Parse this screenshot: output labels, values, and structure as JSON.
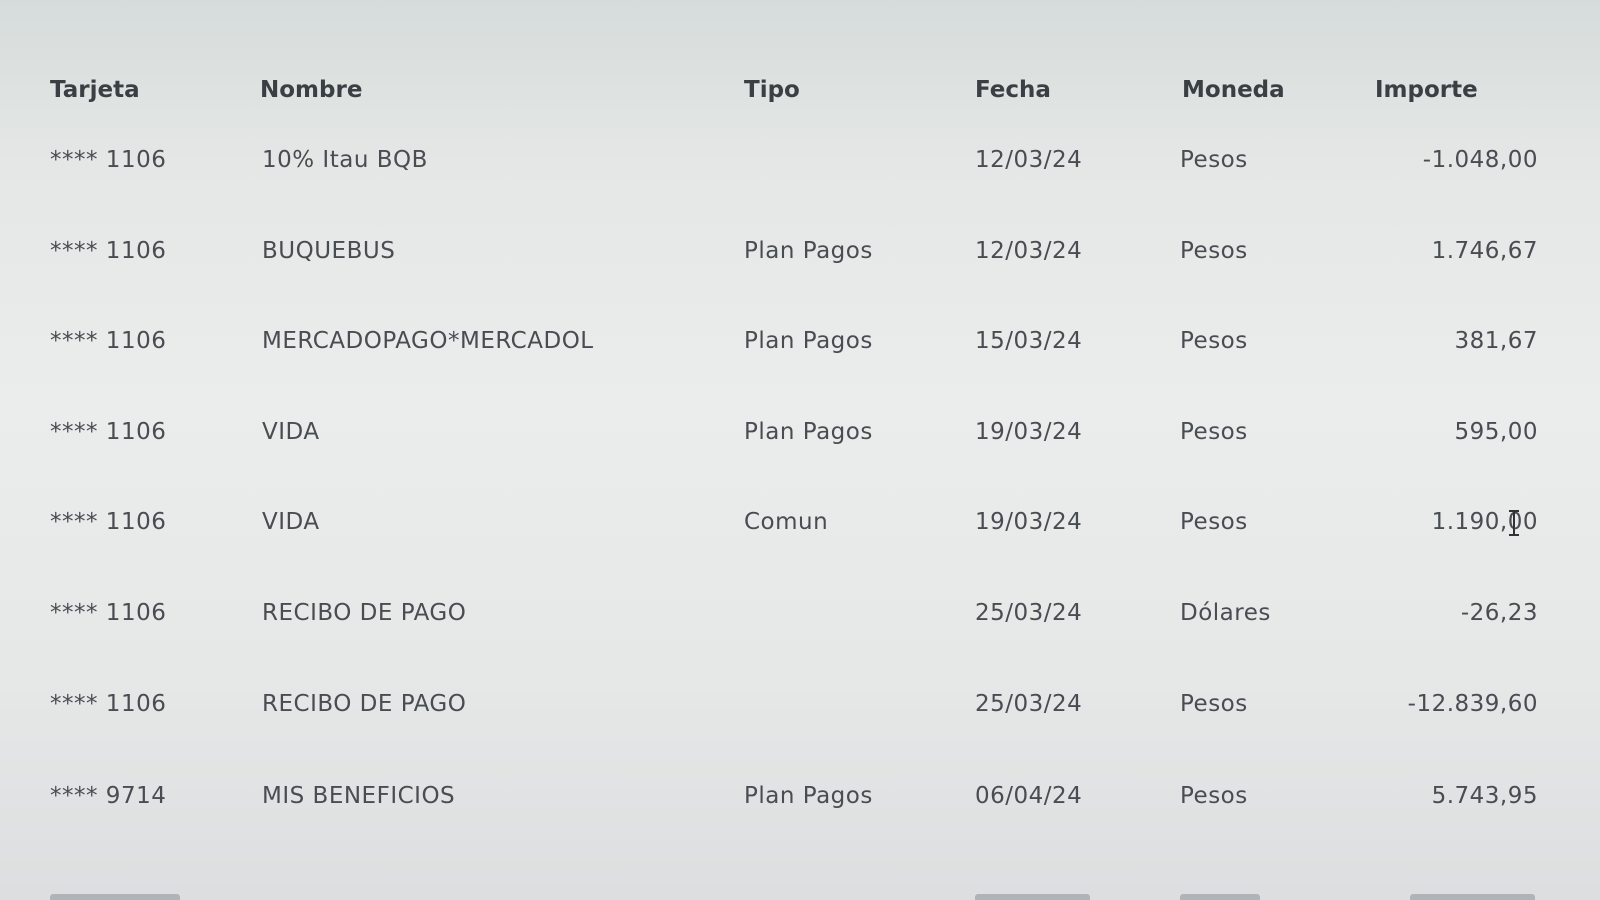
{
  "table": {
    "columns": [
      "Tarjeta",
      "Nombre",
      "Tipo",
      "Fecha",
      "Moneda",
      "Importe"
    ],
    "rows": [
      {
        "tarjeta": "**** 1106",
        "nombre": "10% Itau BQB",
        "tipo": "",
        "fecha": "12/03/24",
        "moneda": "Pesos",
        "importe": "-1.048,00"
      },
      {
        "tarjeta": "**** 1106",
        "nombre": "BUQUEBUS",
        "tipo": "Plan Pagos",
        "fecha": "12/03/24",
        "moneda": "Pesos",
        "importe": "1.746,67"
      },
      {
        "tarjeta": "**** 1106",
        "nombre": "MERCADOPAGO*MERCADOL",
        "tipo": "Plan Pagos",
        "fecha": "15/03/24",
        "moneda": "Pesos",
        "importe": "381,67"
      },
      {
        "tarjeta": "**** 1106",
        "nombre": "VIDA",
        "tipo": "Plan Pagos",
        "fecha": "19/03/24",
        "moneda": "Pesos",
        "importe": "595,00"
      },
      {
        "tarjeta": "**** 1106",
        "nombre": "VIDA",
        "tipo": "Comun",
        "fecha": "19/03/24",
        "moneda": "Pesos",
        "importe": "1.190,00"
      },
      {
        "tarjeta": "**** 1106",
        "nombre": "RECIBO DE PAGO",
        "tipo": "",
        "fecha": "25/03/24",
        "moneda": "Dólares",
        "importe": "-26,23"
      },
      {
        "tarjeta": "**** 1106",
        "nombre": "RECIBO DE PAGO",
        "tipo": "",
        "fecha": "25/03/24",
        "moneda": "Pesos",
        "importe": "-12.839,60"
      },
      {
        "tarjeta": "**** 9714",
        "nombre": "MIS BENEFICIOS",
        "tipo": "Plan Pagos",
        "fecha": "06/04/24",
        "moneda": "Pesos",
        "importe": "5.743,95"
      }
    ]
  },
  "cursor": {
    "icon": "text-cursor-icon"
  },
  "colors": {
    "text": "#484d52",
    "header": "#3a3f44"
  }
}
